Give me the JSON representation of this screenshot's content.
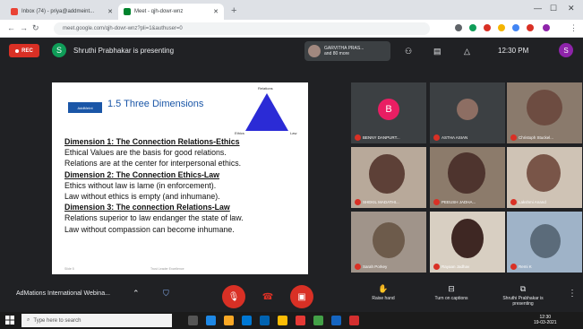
{
  "browser": {
    "tabs": [
      {
        "label": "Inbox (74) - priya@addmeint...",
        "active": false
      },
      {
        "label": "Meet - qjh-dowr-wnz",
        "active": true
      }
    ],
    "url": "meet.google.com/qjh-dowr-wnz?pli=1&authuser=0"
  },
  "meet_top": {
    "rec_label": "REC",
    "presenter_initial": "S",
    "presenting_text": "Shruthi Prabhakar is presenting",
    "others_text_1": "GARVITHA PRAS...",
    "others_text_2": "and 80 more",
    "time": "12:30 PM",
    "user_initial": "S"
  },
  "slide": {
    "logo_text": "AddMeInt",
    "title": "1.5 Three Dimensions",
    "triangle_labels": {
      "top": "Relations",
      "left": "Ethics",
      "right": "Law"
    },
    "lines": [
      {
        "text": "Dimension 1: The Connection Relations-Ethics",
        "head": true
      },
      {
        "text": "Ethical Values are the basis for good relations.",
        "head": false
      },
      {
        "text": "Relations are at the center for interpersonal ethics.",
        "head": false
      },
      {
        "text": "Dimension 2: The Connection Ethics-Law",
        "head": true
      },
      {
        "text": "Ethics without law is lame (in enforcement).",
        "head": false
      },
      {
        "text": "Law without ethics is empty (and inhumane).",
        "head": false
      },
      {
        "text": "Dimension 3: The connection Relations-Law",
        "head": true
      },
      {
        "text": "Relations superior to law endanger the state of law.",
        "head": false
      },
      {
        "text": "Law without compassion can become inhumane.",
        "head": false
      }
    ],
    "footer_left": "Slide 5",
    "footer_center": "Trust Leader Excellence"
  },
  "participants": [
    {
      "name": "BENNY DANPURT...",
      "kind": "letter",
      "initial": "B",
      "color": "#e91e63"
    },
    {
      "name": "ASTHA ASIAN",
      "kind": "photo",
      "color": "#8d6e63"
    },
    {
      "name": "Christoph Stuckel...",
      "kind": "video",
      "color": "#6d4c41"
    },
    {
      "name": "SHEKIL MADATHI...",
      "kind": "video",
      "color": "#5d4037"
    },
    {
      "name": "PEEUSH JADHA...",
      "kind": "video",
      "color": "#4e342e"
    },
    {
      "name": "Lakshmi Anand",
      "kind": "video",
      "color": "#795548"
    },
    {
      "name": "Sarah Porkey",
      "kind": "video",
      "color": "#6d5b4b"
    },
    {
      "name": "Rayaan Jadhav",
      "kind": "video",
      "color": "#3e2723"
    },
    {
      "name": "Remi K",
      "kind": "video",
      "color": "#5b6b7a"
    }
  ],
  "bottom": {
    "meeting_title": "AdMations International Webina...",
    "raise_hand": "Raise hand",
    "captions": "Turn on captions",
    "presenting": "Shruthi Prabhakar is presenting"
  },
  "taskbar": {
    "search_placeholder": "Type here to search",
    "time": "12:30",
    "date": "19-03-2021"
  },
  "colors": {
    "rec": "#d93025",
    "slide_title": "#1a56a7",
    "triangle": "#2b2bd6",
    "end_call": "#d93025"
  }
}
